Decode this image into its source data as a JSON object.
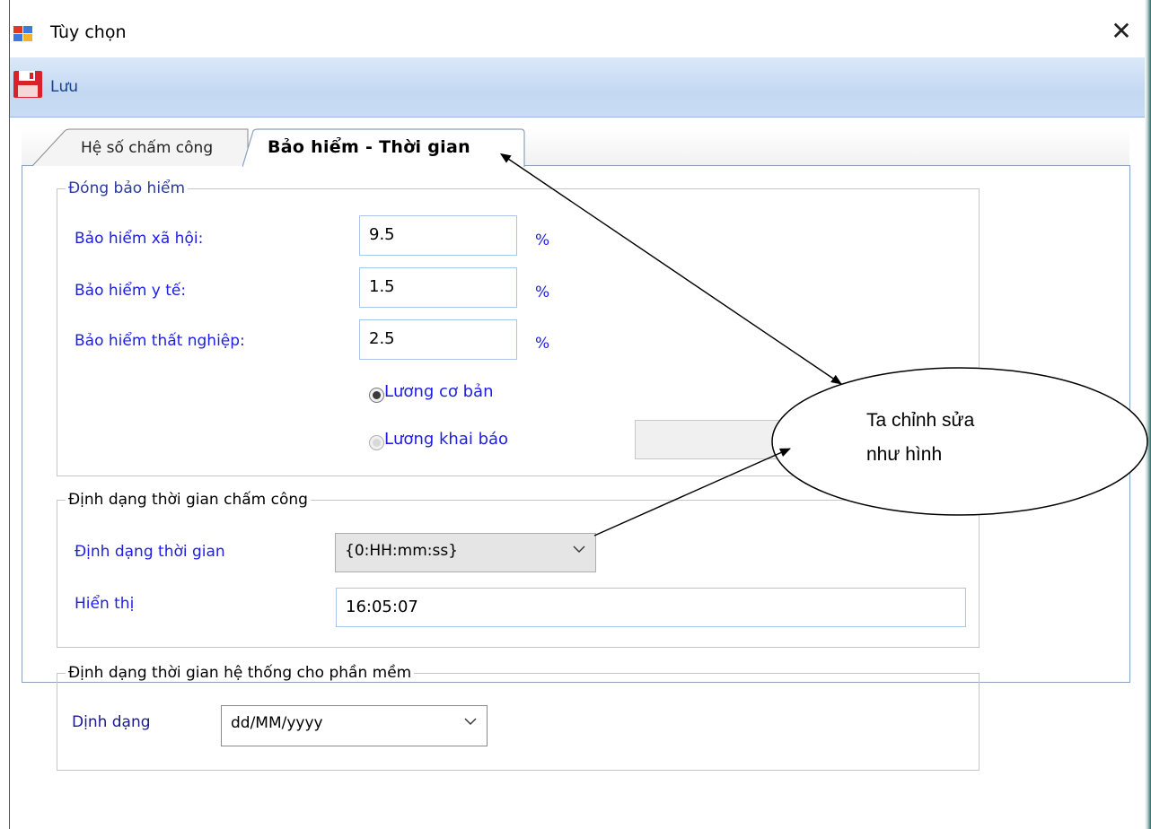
{
  "window": {
    "title": "Tùy chọn",
    "app_icon": "window-app-icon",
    "close_icon": "close-icon",
    "close_glyph": "✕"
  },
  "toolbar": {
    "save_label": "Lưu",
    "save_icon": "floppy-disk-icon"
  },
  "tabs": [
    {
      "label": "Hệ số chấm công",
      "active": false
    },
    {
      "label": "Bảo hiểm - Thời gian",
      "active": true
    }
  ],
  "insurance": {
    "legend": "Đóng bảo hiểm",
    "social_label": "Bảo hiểm xã hội:",
    "social_value": "9.5",
    "health_label": "Bảo hiểm y tế:",
    "health_value": "1.5",
    "unemployment_label": "Bảo hiểm thất nghiệp:",
    "unemployment_value": "2.5",
    "percent_unit": "%",
    "radio_base_salary": "Lương cơ bản",
    "radio_declared_salary": "Lương khai báo",
    "selected_radio": "Lương cơ bản",
    "declared_salary_value": ""
  },
  "attendance_time": {
    "legend": "Định dạng thời gian chấm công",
    "format_label": "Định dạng thời gian",
    "format_value": "{0:HH:mm:ss}",
    "display_label": "Hiển thị",
    "display_value": "16:05:07"
  },
  "system_time": {
    "legend": "Định dạng thời gian hệ thống cho phần mềm",
    "format_label": "Dịnh dạng",
    "format_value": "dd/MM/yyyy"
  },
  "annotation": {
    "callout_line1": "Ta chỉnh sửa",
    "callout_line2": "như hình"
  },
  "colors": {
    "label_blue": "#1d1de6",
    "toolbar_blue": "#c4d8f2",
    "save_red": "#d9212c"
  }
}
